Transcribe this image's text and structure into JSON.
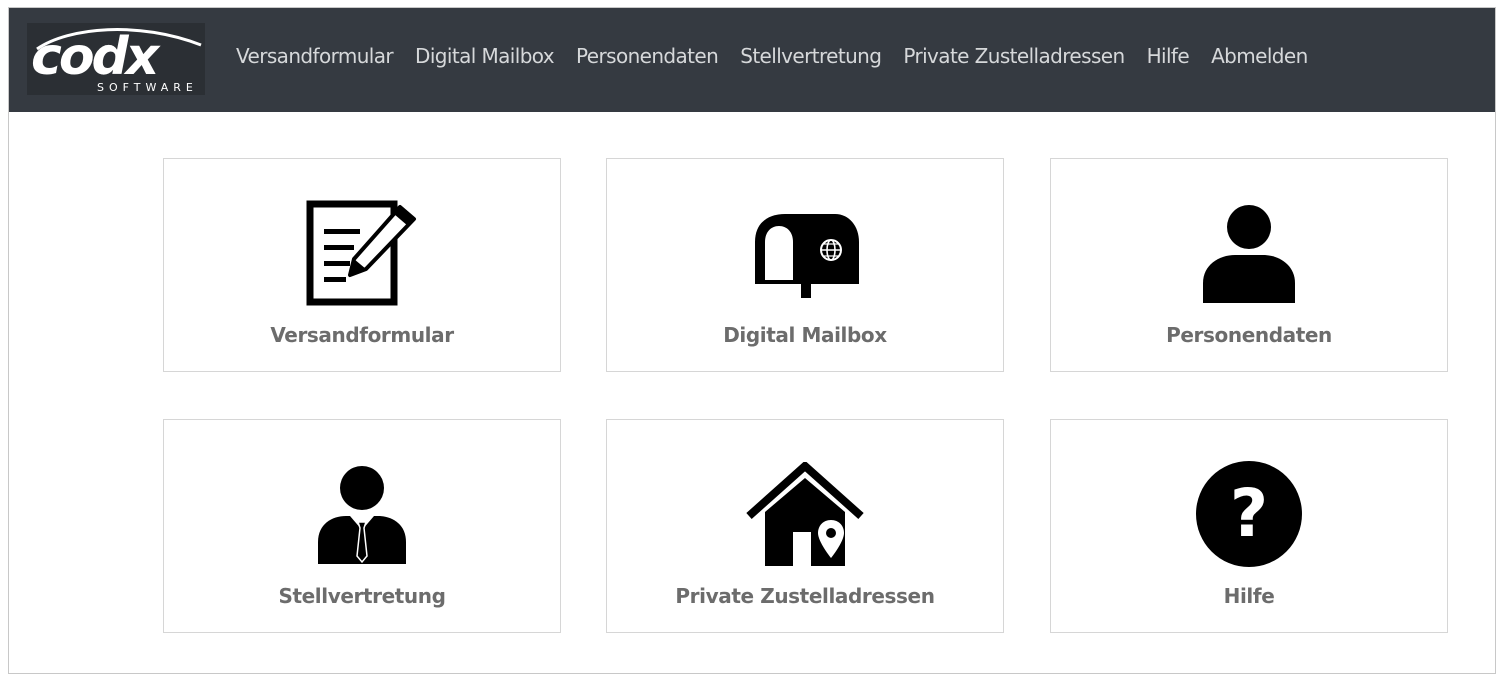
{
  "logo": {
    "word": "codx",
    "sub": "SOFTWARE"
  },
  "nav": {
    "items": [
      "Versandformular",
      "Digital Mailbox",
      "Personendaten",
      "Stellvertretung",
      "Private Zustelladressen",
      "Hilfe",
      "Abmelden"
    ]
  },
  "tiles": [
    {
      "label": "Versandformular",
      "icon": "form-edit-icon"
    },
    {
      "label": "Digital Mailbox",
      "icon": "mailbox-globe-icon"
    },
    {
      "label": "Personendaten",
      "icon": "person-icon"
    },
    {
      "label": "Stellvertretung",
      "icon": "businessman-icon"
    },
    {
      "label": "Private Zustelladressen",
      "icon": "house-location-icon"
    },
    {
      "label": "Hilfe",
      "icon": "question-circle-icon"
    }
  ],
  "colors": {
    "navbar": "#353a41",
    "tile_label": "#6c6c6c",
    "nav_text": "#d6d8da"
  }
}
